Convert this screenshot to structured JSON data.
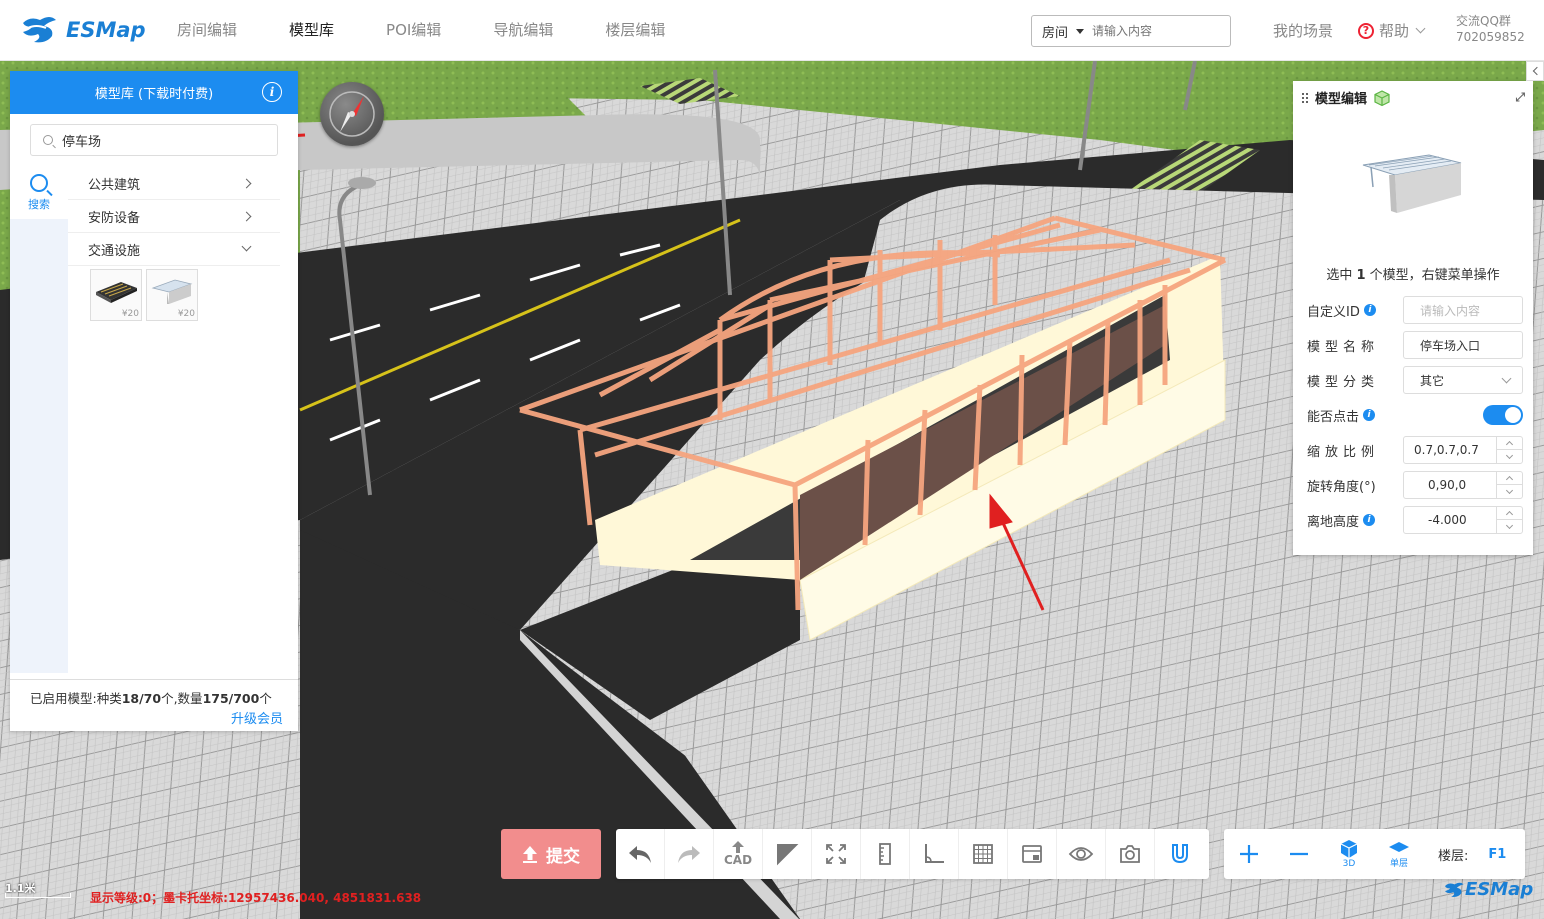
{
  "header": {
    "logo_text": "ESMap",
    "nav": [
      "房间编辑",
      "模型库",
      "POI编辑",
      "导航编辑",
      "楼层编辑"
    ],
    "active_nav": "模型库",
    "search_type": "房间",
    "search_placeholder": "请输入内容",
    "my_scene": "我的场景",
    "help": "帮助",
    "qq_label": "交流QQ群",
    "qq_number": "702059852"
  },
  "left_panel": {
    "title": "模型库 (下载时付费)",
    "search_value": "停车场",
    "side_tab": "搜索",
    "categories": [
      {
        "label": "公共建筑",
        "expanded": false
      },
      {
        "label": "安防设备",
        "expanded": false
      },
      {
        "label": "交通设施",
        "expanded": true
      }
    ],
    "models": [
      {
        "name": "parking-lot-model",
        "price": "¥20"
      },
      {
        "name": "parking-entrance-model",
        "price": "¥20"
      }
    ],
    "footer_prefix": "已启用模型:种类",
    "footer_kinds": "18/70",
    "footer_mid": "个,数量",
    "footer_count": "175/700",
    "footer_suffix": "个",
    "upgrade": "升级会员"
  },
  "right_panel": {
    "title": "模型编辑",
    "selected_prefix": "选中 ",
    "selected_count": "1",
    "selected_suffix": " 个模型，右键菜单操作",
    "fields": {
      "custom_id_label": "自定义ID",
      "custom_id_placeholder": "请输入内容",
      "model_name_label": "模型名称",
      "model_name_value": "停车场入口",
      "model_type_label": "模型分类",
      "model_type_value": "其它",
      "clickable_label": "能否点击",
      "clickable_on": true,
      "scale_label": "缩放比例",
      "scale_value": "0.7,0.7,0.7",
      "rotation_label": "旋转角度(°)",
      "rotation_value": "0,90,0",
      "height_label": "离地高度",
      "height_value": "-4.000"
    }
  },
  "bottom": {
    "submit": "提交",
    "cad_label": "CAD",
    "view_3d": "3D",
    "single_floor": "单层",
    "floor_label": "楼层:",
    "floor_value": "F1",
    "scale_text": "1.1米",
    "status_text": "显示等级:0；墨卡托坐标:12957436.040, 4851831.638",
    "watermark": "ESMap"
  },
  "colors": {
    "accent": "#1c8cf0",
    "submit_bg": "#f28d8d",
    "status_red": "#e02020",
    "model_frame": "#f6a57f"
  }
}
